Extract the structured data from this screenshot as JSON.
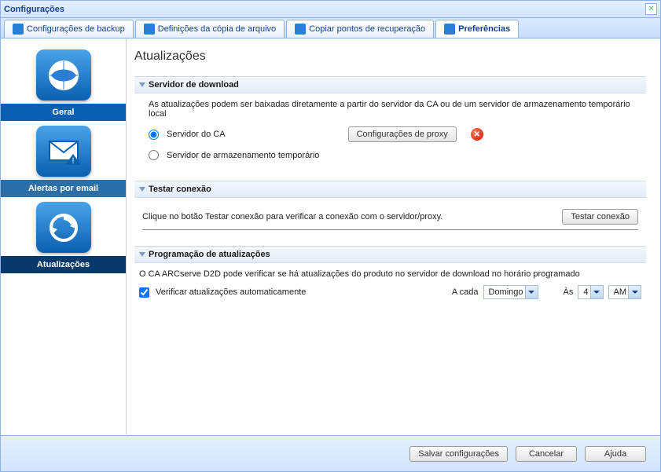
{
  "window": {
    "title": "Configurações"
  },
  "tabs": {
    "backup": "Configurações de backup",
    "filecopy": "Definições da cópia de arquivo",
    "recovery": "Copiar pontos de recuperação",
    "prefs": "Preferências"
  },
  "sidebar": {
    "general": "Geral",
    "email": "Alertas por email",
    "updates": "Atualizações"
  },
  "page": {
    "title": "Atualizações",
    "download_server_header": "Servidor de download",
    "download_desc": "As atualizações podem ser baixadas diretamente a partir do servidor da CA ou de um servidor de armazenamento temporário local",
    "radio_ca": "Servidor do CA",
    "radio_staging": "Servidor de armazenamento temporário",
    "proxy_btn": "Configurações de proxy",
    "test_header": "Testar conexão",
    "test_desc": "Clique no botão Testar conexão para verificar a conexão com o servidor/proxy.",
    "test_btn": "Testar conexão",
    "sched_header": "Programação de atualizações",
    "sched_desc": "O CA ARCserve D2D pode verificar se há atualizações do produto no servidor de download no horário programado",
    "check_auto": "Verificar atualizações automaticamente",
    "every_label": "A cada",
    "day_value": "Domingo",
    "at_label": "Às",
    "hour_value": "4",
    "ampm_value": "AM"
  },
  "footer": {
    "save": "Salvar configurações",
    "cancel": "Cancelar",
    "help": "Ajuda"
  }
}
